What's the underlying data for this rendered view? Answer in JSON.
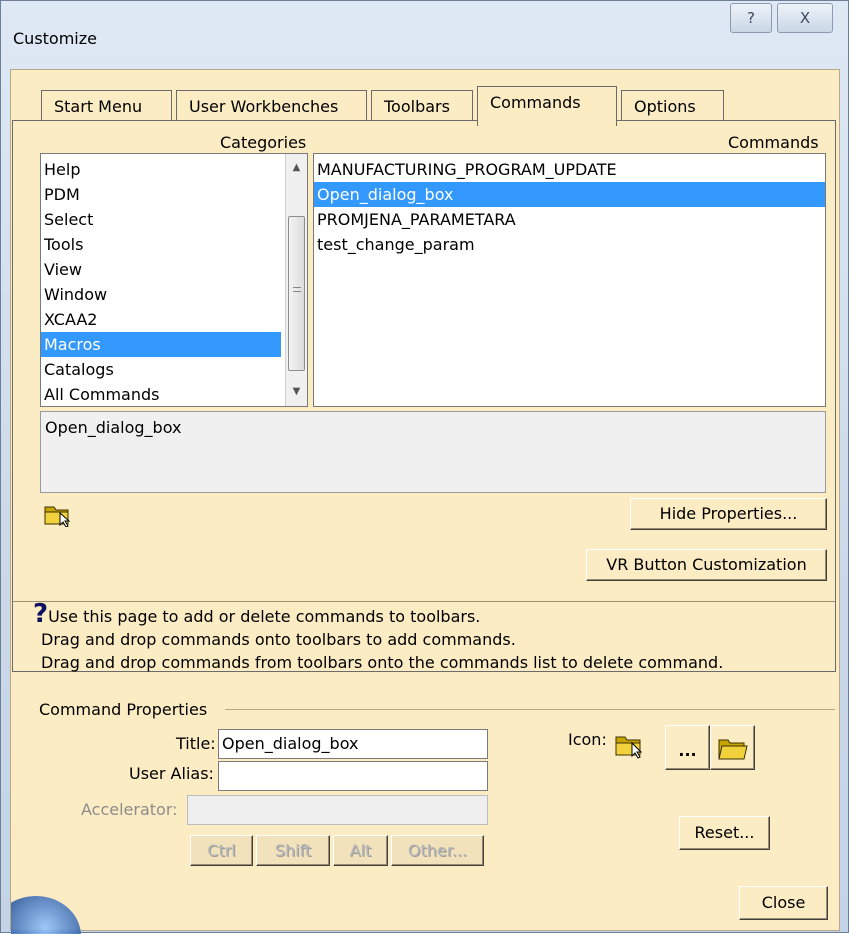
{
  "window": {
    "title": "Customize",
    "help_btn": "?",
    "close_btn": "X"
  },
  "tabs": [
    {
      "label": "Start Menu"
    },
    {
      "label": "User Workbenches"
    },
    {
      "label": "Toolbars"
    },
    {
      "label": "Commands",
      "active": true
    },
    {
      "label": "Options"
    }
  ],
  "categories": {
    "header": "Categories",
    "items": [
      "Help",
      "PDM",
      "Select",
      "Tools",
      "View",
      "Window",
      "XCAA2",
      "Macros",
      "Catalogs",
      "All Commands"
    ],
    "selected": "Macros"
  },
  "commands": {
    "header": "Commands",
    "items": [
      "MANUFACTURING_PROGRAM_UPDATE",
      "Open_dialog_box",
      "PROMJENA_PARAMETARA",
      "test_change_param"
    ],
    "selected": "Open_dialog_box"
  },
  "description": "Open_dialog_box",
  "buttons": {
    "hide_properties": "Hide Properties...",
    "vr_button": "VR Button Customization",
    "reset": "Reset...",
    "close": "Close",
    "icon_browse": "...",
    "ctrl": "Ctrl",
    "shift": "Shift",
    "alt": "Alt",
    "other": "Other..."
  },
  "help": {
    "line1": "Use this page to add or delete commands to toolbars.",
    "line2": "Drag and drop commands onto toolbars to add commands.",
    "line3": "Drag and drop commands from toolbars onto the commands list to delete command."
  },
  "properties": {
    "group_label": "Command Properties",
    "title_label": "Title:",
    "title_value": "Open_dialog_box",
    "alias_label": "User Alias:",
    "alias_value": "",
    "accelerator_label": "Accelerator:",
    "accelerator_value": "",
    "icon_label": "Icon:"
  },
  "icons": [
    "folder-cursor-icon",
    "open-folder-icon"
  ],
  "colors": {
    "panel_bg": "#fcecc4",
    "selection": "#3399ff",
    "title_bar": "#cbd9ea"
  }
}
